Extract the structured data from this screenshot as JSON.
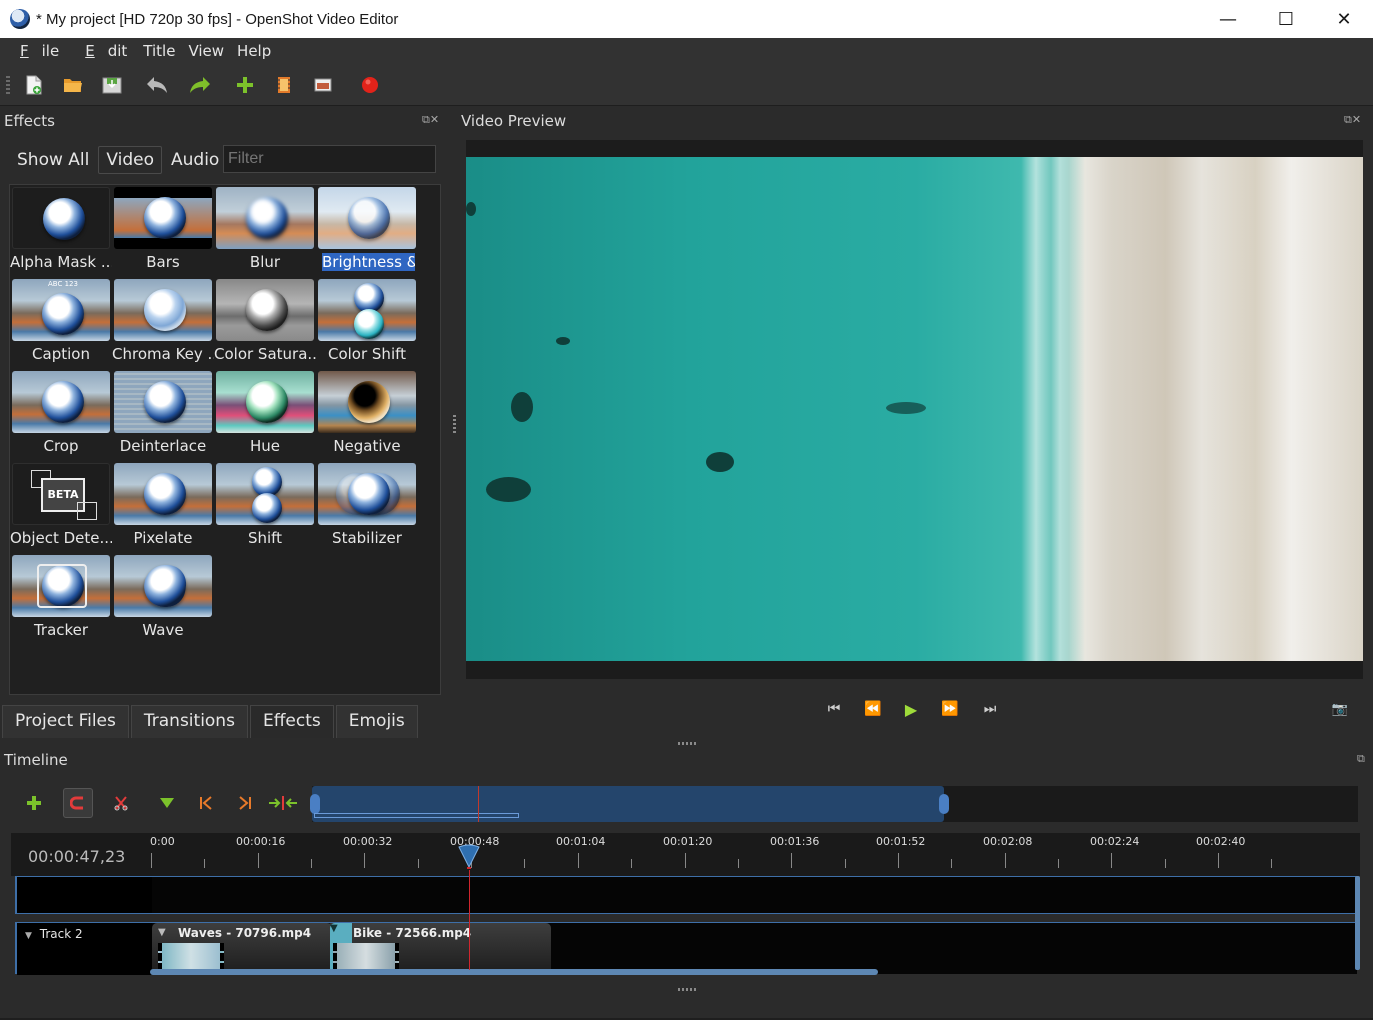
{
  "window": {
    "title": "* My project [HD 720p 30 fps] - OpenShot Video Editor",
    "minimize": "—",
    "maximize": "☐",
    "close": "✕"
  },
  "menu": [
    {
      "pre": "",
      "u": "F",
      "post": "ile"
    },
    {
      "pre": "",
      "u": "E",
      "post": "dit"
    },
    {
      "pre": "",
      "u": "",
      "post": "Title"
    },
    {
      "pre": "",
      "u": "",
      "post": "View"
    },
    {
      "pre": "",
      "u": "",
      "post": "Help"
    }
  ],
  "toolbar": {
    "icons": [
      "new-project-icon",
      "open-project-icon",
      "save-project-icon",
      "undo-icon",
      "redo-icon",
      "import-files-icon",
      "choose-profile-icon",
      "fullscreen-icon",
      "export-video-icon"
    ]
  },
  "effects_panel": {
    "title": "Effects",
    "tabs": [
      "Show All",
      "Video",
      "Audio"
    ],
    "active_tab": "Video",
    "filter_placeholder": "Filter",
    "items": [
      "Alpha Mask ...",
      "Bars",
      "Blur",
      "Brightness &...",
      "Caption",
      "Chroma Key ...",
      "Color Satura...",
      "Color Shift",
      "Crop",
      "Deinterlace",
      "Hue",
      "Negative",
      "Object Dete...",
      "Pixelate",
      "Shift",
      "Stabilizer",
      "Tracker",
      "Wave"
    ],
    "selected_item": "Brightness &...",
    "beta_badge": "BETA",
    "caption_badge": "ABC 123"
  },
  "bottom_tabs": [
    "Project Files",
    "Transitions",
    "Effects",
    "Emojis"
  ],
  "active_bottom_tab": "Effects",
  "preview": {
    "title": "Video Preview"
  },
  "timeline": {
    "title": "Timeline",
    "timecode": "00:00:47,23",
    "ticks": [
      "0:00",
      "00:00:16",
      "00:00:32",
      "00:00:48",
      "00:01:04",
      "00:01:20",
      "00:01:36",
      "00:01:52",
      "00:02:08",
      "00:02:24",
      "00:02:40"
    ],
    "tracks": [
      {
        "name": ""
      },
      {
        "name": "Track 2",
        "clips": [
          "Waves - 70796.mp4",
          "Bike - 72566.mp4"
        ]
      }
    ]
  },
  "colors": {
    "accent": "#2f66c2",
    "playhead": "#d0262e",
    "timeline_selection": "#24456c"
  }
}
